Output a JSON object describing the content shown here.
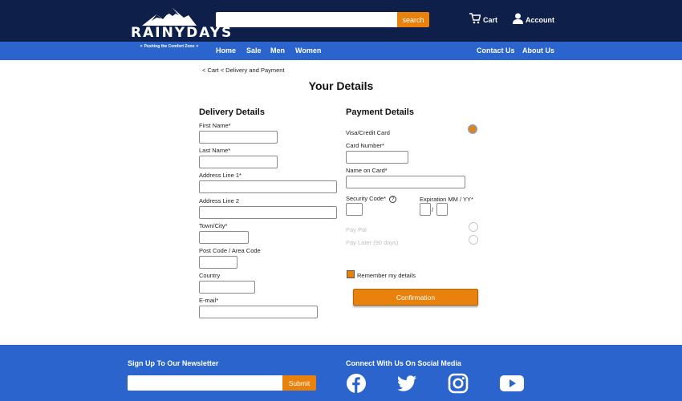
{
  "brand": {
    "logo_text": "RAINYDAYS",
    "tagline": "✕ Pushing the Comfort Zone ✕"
  },
  "header": {
    "search_placeholder": "",
    "search_button": "search",
    "cart_label": "Cart",
    "account_label": "Account"
  },
  "nav": {
    "left": [
      "Home",
      "Sale",
      "Men",
      "Women"
    ],
    "right": [
      "Contact Us",
      "About Us"
    ]
  },
  "breadcrumb": "< Cart < Delivery and Payment",
  "page_title": "Your Details",
  "delivery": {
    "title": "Delivery Details",
    "fields": [
      "First Name*",
      "Last Name*",
      "Address Line 1*",
      "Address Line 2",
      "Town/City*",
      "Post Code / Area Code",
      "Country",
      "E-mail*"
    ]
  },
  "payment": {
    "title": "Payment Details",
    "card_option": "Visa/Credit Card",
    "card_number": "Card Number*",
    "name_on_card": "Name on Card*",
    "security_code": "Security Code*",
    "help_glyph": "?",
    "expiration": "Expiration MM / YY*",
    "separator": "/",
    "paypal": "Pay Pal",
    "pay_later": "Pay Later (90 days)",
    "remember": "Remember my details",
    "confirm_button": "Confirmation"
  },
  "footer": {
    "newsletter_title": "Sign Up To Our Newsletter",
    "newsletter_button": "Submit",
    "social_title": "Connect With Us On Social Media"
  },
  "icons": [
    "mountain-logo-icon",
    "cart-icon",
    "account-icon",
    "help-icon",
    "facebook-icon",
    "twitter-icon",
    "instagram-icon",
    "youtube-icon"
  ],
  "colors": {
    "header_bg": "#0e1f4a",
    "nav_bg": "#2a64cc",
    "accent": "#e8820c"
  }
}
